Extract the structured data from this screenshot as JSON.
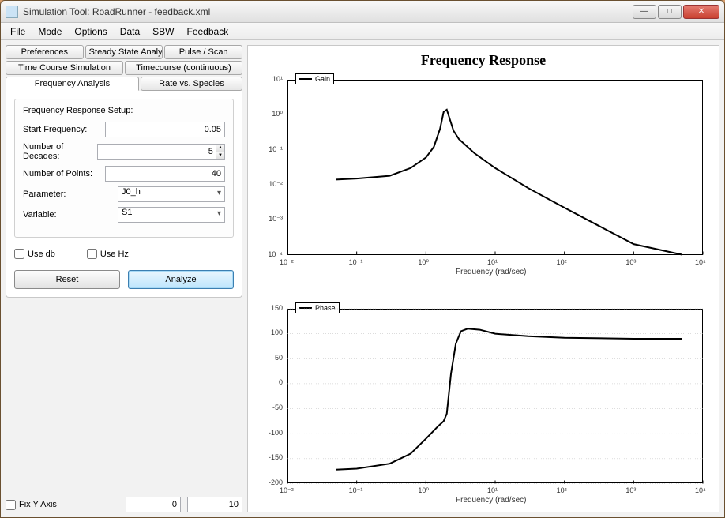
{
  "window": {
    "title": "Simulation Tool: RoadRunner - feedback.xml"
  },
  "menu": {
    "file": "File",
    "mode": "Mode",
    "options": "Options",
    "data": "Data",
    "sbw": "SBW",
    "feedback": "Feedback"
  },
  "tabs": {
    "preferences": "Preferences",
    "steady_state": "Steady State Analysis",
    "pulse_scan": "Pulse / Scan",
    "timecourse_sim": "Time Course Simulation",
    "timecourse_cont": "Timecourse (continuous)",
    "freq_analysis": "Frequency Analysis",
    "rate_species": "Rate vs. Species"
  },
  "form": {
    "group_title": "Frequency Response Setup:",
    "start_freq_label": "Start Frequency:",
    "start_freq": "0.05",
    "decades_label": "Number of Decades:",
    "decades": "5",
    "points_label": "Number of Points:",
    "points": "40",
    "parameter_label": "Parameter:",
    "parameter": "J0_h",
    "variable_label": "Variable:",
    "variable": "S1",
    "use_db": "Use db",
    "use_hz": "Use Hz",
    "reset": "Reset",
    "analyze": "Analyze",
    "fix_y": "Fix Y Axis",
    "ymin": "0",
    "ymax": "10"
  },
  "chart": {
    "title": "Frequency Response",
    "xlabel": "Frequency (rad/sec)",
    "legend_gain": "Gain",
    "legend_phase": "Phase"
  },
  "chart_data": [
    {
      "type": "line",
      "name": "Gain",
      "xscale": "log",
      "yscale": "log",
      "xlim": [
        0.01,
        10000
      ],
      "ylim": [
        0.0001,
        10
      ],
      "xticks": [
        0.01,
        0.1,
        1,
        10,
        100,
        1000,
        10000
      ],
      "yticks": [
        0.0001,
        0.001,
        0.01,
        0.1,
        1,
        10
      ],
      "xticklabels": [
        "10⁻²",
        "10⁻¹",
        "10⁰",
        "10¹",
        "10²",
        "10³",
        "10⁴"
      ],
      "yticklabels": [
        "10⁻⁴",
        "10⁻³",
        "10⁻²",
        "10⁻¹",
        "10⁰",
        "10¹"
      ],
      "x": [
        0.05,
        0.1,
        0.3,
        0.6,
        1.0,
        1.3,
        1.6,
        1.8,
        2.0,
        2.5,
        3,
        5,
        10,
        30,
        100,
        300,
        1000,
        5000
      ],
      "y": [
        0.014,
        0.015,
        0.018,
        0.03,
        0.06,
        0.12,
        0.4,
        1.2,
        1.4,
        0.35,
        0.2,
        0.08,
        0.03,
        0.008,
        0.0022,
        0.0007,
        0.0002,
        0.0001
      ],
      "xlabel": "Frequency (rad/sec)",
      "ylabel": ""
    },
    {
      "type": "line",
      "name": "Phase",
      "xscale": "log",
      "yscale": "linear",
      "xlim": [
        0.01,
        10000
      ],
      "ylim": [
        -200,
        150
      ],
      "xticks": [
        0.01,
        0.1,
        1,
        10,
        100,
        1000,
        10000
      ],
      "yticks": [
        -200,
        -150,
        -100,
        -50,
        0,
        50,
        100,
        150
      ],
      "xticklabels": [
        "10⁻²",
        "10⁻¹",
        "10⁰",
        "10¹",
        "10²",
        "10³",
        "10⁴"
      ],
      "yticklabels": [
        "-200",
        "-150",
        "-100",
        "-50",
        "0",
        "50",
        "100",
        "150"
      ],
      "x": [
        0.05,
        0.1,
        0.3,
        0.6,
        1.0,
        1.5,
        1.8,
        2.0,
        2.3,
        2.7,
        3.2,
        4,
        6,
        10,
        30,
        100,
        1000,
        5000
      ],
      "y": [
        -172,
        -170,
        -160,
        -140,
        -110,
        -85,
        -75,
        -60,
        20,
        80,
        105,
        110,
        108,
        100,
        95,
        92,
        90,
        90
      ],
      "xlabel": "Frequency (rad/sec)",
      "ylabel": ""
    }
  ]
}
